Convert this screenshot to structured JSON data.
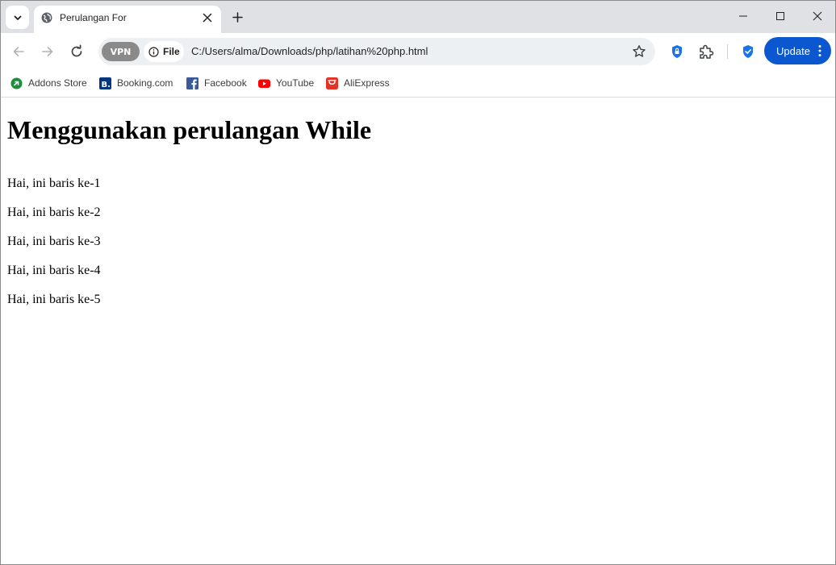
{
  "tab": {
    "title": "Perulangan For"
  },
  "toolbar": {
    "vpn_label": "VPN",
    "file_chip_label": "File",
    "url": "C:/Users/alma/Downloads/php/latihan%20php.html",
    "update_label": "Update"
  },
  "bookmarks": [
    {
      "label": "Addons Store",
      "icon": "addons-store-icon",
      "color": "#1e8e3e"
    },
    {
      "label": "Booking.com",
      "icon": "booking-icon",
      "color": "#003580"
    },
    {
      "label": "Facebook",
      "icon": "facebook-icon",
      "color": "#3b5998"
    },
    {
      "label": "YouTube",
      "icon": "youtube-icon",
      "color": "#ff0000"
    },
    {
      "label": "AliExpress",
      "icon": "aliexpress-icon",
      "color": "#e43225"
    }
  ],
  "page": {
    "heading": "Menggunakan perulangan While",
    "lines": [
      "Hai, ini baris ke-1",
      "Hai, ini baris ke-2",
      "Hai, ini baris ke-3",
      "Hai, ini baris ke-4",
      "Hai, ini baris ke-5"
    ]
  },
  "colors": {
    "accent": "#0b57d0",
    "tabstrip": "#dfe1e5",
    "omnibox": "#edf0f3"
  }
}
